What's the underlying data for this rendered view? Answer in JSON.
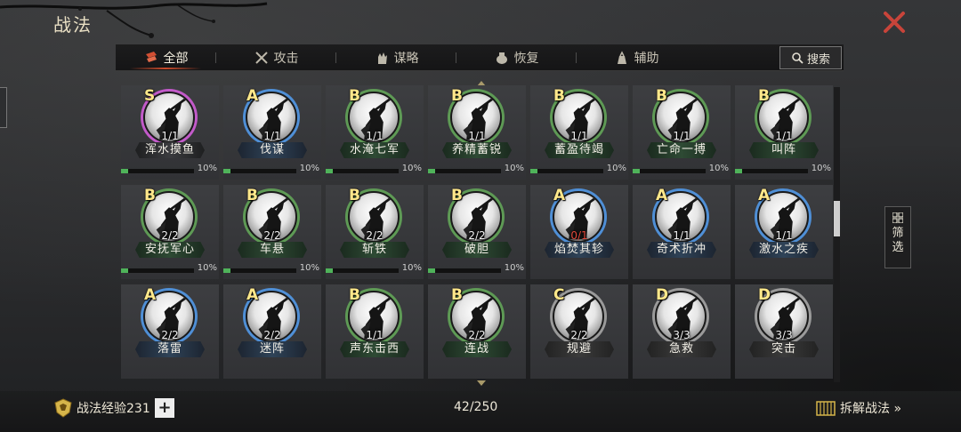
{
  "header": {
    "title": "战法"
  },
  "tabs": [
    {
      "label": "全部",
      "icon": "scroll-icon",
      "active": true
    },
    {
      "label": "攻击",
      "icon": "crossed-swords-icon",
      "active": false
    },
    {
      "label": "谋略",
      "icon": "hand-icon",
      "active": false
    },
    {
      "label": "恢复",
      "icon": "pot-icon",
      "active": false
    },
    {
      "label": "辅助",
      "icon": "bag-icon",
      "active": false
    }
  ],
  "search": {
    "label": "搜索"
  },
  "filter": {
    "label_1": "筛",
    "label_2": "选"
  },
  "tactics": [
    {
      "grade": "S",
      "count": "1/1",
      "name": "浑水摸鱼",
      "progress": "10%",
      "progress_value": 0.1,
      "show_progress": true,
      "count_red": false
    },
    {
      "grade": "A",
      "count": "1/1",
      "name": "伐谋",
      "progress": "10%",
      "progress_value": 0.1,
      "show_progress": true,
      "count_red": false
    },
    {
      "grade": "B",
      "count": "1/1",
      "name": "水淹七军",
      "progress": "10%",
      "progress_value": 0.1,
      "show_progress": true,
      "count_red": false
    },
    {
      "grade": "B",
      "count": "1/1",
      "name": "养精蓄锐",
      "progress": "10%",
      "progress_value": 0.1,
      "show_progress": true,
      "count_red": false
    },
    {
      "grade": "B",
      "count": "1/1",
      "name": "蓄盈待竭",
      "progress": "10%",
      "progress_value": 0.1,
      "show_progress": true,
      "count_red": false
    },
    {
      "grade": "B",
      "count": "1/1",
      "name": "亡命一搏",
      "progress": "10%",
      "progress_value": 0.1,
      "show_progress": true,
      "count_red": false
    },
    {
      "grade": "B",
      "count": "1/1",
      "name": "叫阵",
      "progress": "10%",
      "progress_value": 0.1,
      "show_progress": true,
      "count_red": false
    },
    {
      "grade": "B",
      "count": "2/2",
      "name": "安抚军心",
      "progress": "10%",
      "progress_value": 0.1,
      "show_progress": true,
      "count_red": false
    },
    {
      "grade": "B",
      "count": "2/2",
      "name": "车悬",
      "progress": "10%",
      "progress_value": 0.1,
      "show_progress": true,
      "count_red": false
    },
    {
      "grade": "B",
      "count": "2/2",
      "name": "斩铁",
      "progress": "10%",
      "progress_value": 0.1,
      "show_progress": true,
      "count_red": false
    },
    {
      "grade": "B",
      "count": "2/2",
      "name": "破胆",
      "progress": "10%",
      "progress_value": 0.1,
      "show_progress": true,
      "count_red": false
    },
    {
      "grade": "A",
      "count": "0/1",
      "name": "焰焚其轸",
      "progress": "",
      "progress_value": 0,
      "show_progress": false,
      "count_red": true
    },
    {
      "grade": "A",
      "count": "1/1",
      "name": "奇术折冲",
      "progress": "",
      "progress_value": 0,
      "show_progress": false,
      "count_red": false
    },
    {
      "grade": "A",
      "count": "1/1",
      "name": "激水之疾",
      "progress": "",
      "progress_value": 0,
      "show_progress": false,
      "count_red": false
    },
    {
      "grade": "A",
      "count": "2/2",
      "name": "落雷",
      "progress": "",
      "progress_value": 0,
      "show_progress": false,
      "count_red": false
    },
    {
      "grade": "A",
      "count": "2/2",
      "name": "迷阵",
      "progress": "",
      "progress_value": 0,
      "show_progress": false,
      "count_red": false
    },
    {
      "grade": "B",
      "count": "1/1",
      "name": "声东击西",
      "progress": "",
      "progress_value": 0,
      "show_progress": false,
      "count_red": false
    },
    {
      "grade": "B",
      "count": "2/2",
      "name": "连战",
      "progress": "",
      "progress_value": 0,
      "show_progress": false,
      "count_red": false
    },
    {
      "grade": "C",
      "count": "2/2",
      "name": "规避",
      "progress": "",
      "progress_value": 0,
      "show_progress": false,
      "count_red": false
    },
    {
      "grade": "D",
      "count": "3/3",
      "name": "急救",
      "progress": "",
      "progress_value": 0,
      "show_progress": false,
      "count_red": false
    },
    {
      "grade": "D",
      "count": "3/3",
      "name": "突击",
      "progress": "",
      "progress_value": 0,
      "show_progress": false,
      "count_red": false
    }
  ],
  "grade_colors": {
    "S": "#c25ac9",
    "A": "#4f8fd6",
    "B": "#5e9a55",
    "C": "#9a9a9a",
    "D": "#9a9a9a"
  },
  "footer": {
    "exp_label": "战法经验231",
    "plus_label": "+",
    "capacity": "42/250",
    "dismantle_label": "拆解战法 »"
  }
}
